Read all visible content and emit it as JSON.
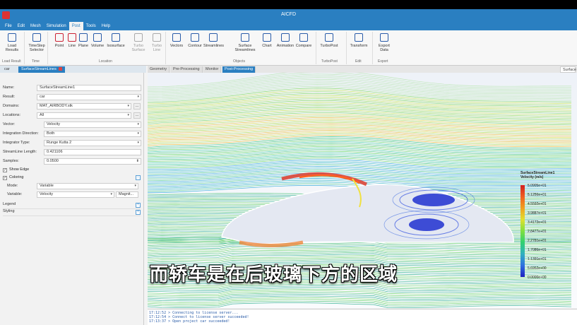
{
  "app": {
    "title": "AICFD"
  },
  "menu": [
    "File",
    "Edit",
    "Mesh",
    "Simulation",
    "Post",
    "Tools",
    "Help"
  ],
  "ribbon": {
    "buttons": [
      {
        "label": "Load\nResults",
        "icon": "load-results-icon"
      },
      {
        "label": "TimeStep\nSelector",
        "icon": "clock-icon"
      },
      {
        "label": "Point",
        "icon": "point-icon"
      },
      {
        "label": "Line",
        "icon": "line-icon"
      },
      {
        "label": "Plane",
        "icon": "plane-icon"
      },
      {
        "label": "Volume",
        "icon": "volume-icon"
      },
      {
        "label": "Isosurface",
        "icon": "isosurface-icon"
      },
      {
        "label": "Turbo\nSurface",
        "icon": "turbo-surface-icon"
      },
      {
        "label": "Turbo\nLine",
        "icon": "turbo-line-icon"
      },
      {
        "label": "Vectors",
        "icon": "vectors-icon"
      },
      {
        "label": "Contour",
        "icon": "contour-icon"
      },
      {
        "label": "Streamlines",
        "icon": "streamlines-icon"
      },
      {
        "label": "Surface\nStreamlines",
        "icon": "surface-streamlines-icon"
      },
      {
        "label": "Chart",
        "icon": "chart-icon"
      },
      {
        "label": "Animation",
        "icon": "animation-icon"
      },
      {
        "label": "Compare",
        "icon": "compare-icon"
      },
      {
        "label": "TurboPost",
        "icon": "turbopost-icon"
      },
      {
        "label": "Transform",
        "icon": "transform-icon"
      },
      {
        "label": "Export\nData",
        "icon": "export-data-icon"
      }
    ],
    "groups": [
      "Load Result",
      "Time",
      "Location",
      "Objects",
      "TurboPost",
      "Edit",
      "Export"
    ]
  },
  "left_tabs": {
    "tab1": "car",
    "tab2": "SurfaceStreamLines"
  },
  "properties": {
    "name_label": "Name:",
    "name_value": "SurfaceStreamLine1",
    "result_label": "Result:",
    "result_value": "car",
    "domains_label": "Domains:",
    "domains_value": "MAT_AIRBODY.stk",
    "locations_label": "Locations:",
    "locations_value": "All",
    "vector_label": "Vector:",
    "vector_value": "Velocity",
    "direction_label": "Integration Direction:",
    "direction_value": "Both",
    "integrator_label": "Integrator Type:",
    "integrator_value": "Runge Kutta 2",
    "length_label": "StreamLine Length:",
    "length_value": "0.421106",
    "samples_label": "Samples:",
    "samples_value": "0.0500",
    "show_edge_label": "Show Edge",
    "coloring_label": "Coloring",
    "mode_label": "Mode:",
    "mode_value": "Variable",
    "variable_label": "Variable:",
    "variable_value": "Velocity",
    "variable_extra": "Magnit...",
    "legend_label": "Legend",
    "styling_label": "Styling"
  },
  "view_tabs": [
    "Geometry",
    "Pre-Processing",
    "Monitor",
    "Post-Processing"
  ],
  "view_search": "Surface",
  "legend": {
    "title1": "SurfaceStreamLine1",
    "title2": "Velocity (m/s)",
    "ticks": [
      "5.0905e+01",
      "5.1256e+01",
      "4.5592e+01",
      "3.9887e+01",
      "3.4172e+01",
      "2.8477e+01",
      "2.2781e+01",
      "1.7086e+01",
      "1.1391e+01",
      "5.6952e+00",
      "0.0000e+00"
    ]
  },
  "console": [
    "17:12:52 > Connecting to license server...",
    "17:12:54 > Connect to license server succeeded!",
    "17:13:37 > Open project car succeeded!"
  ],
  "subtitle": "而轿车是在后玻璃下方的区域"
}
